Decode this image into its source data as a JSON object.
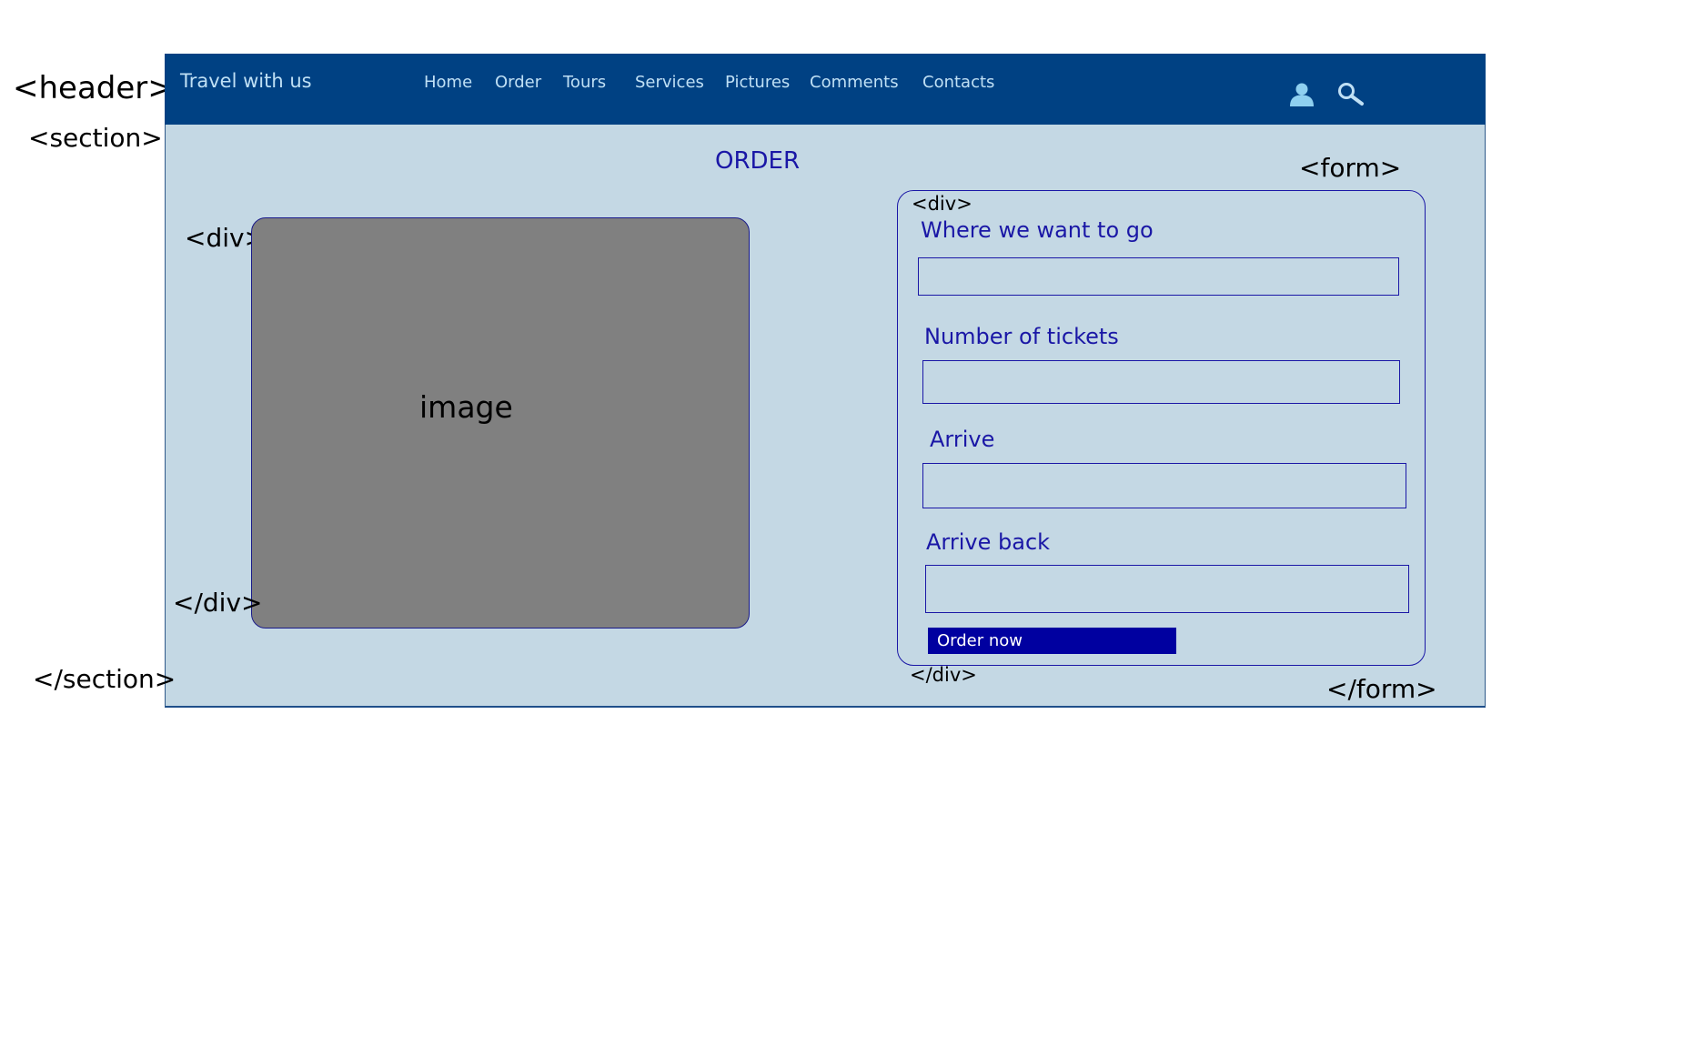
{
  "annotations": {
    "header_open": "<header>",
    "section_open": "<section>",
    "section_close": "</section>",
    "div_open": "<div>",
    "div_close": "</div>",
    "form_open": "<form>",
    "form_close": "</form>",
    "form_div_open": "<div>",
    "form_div_close": "</div>"
  },
  "header": {
    "brand": "Travel with us",
    "nav": [
      "Home",
      "Order",
      "Tours",
      "Services",
      "Pictures",
      "Comments",
      "Contacts"
    ],
    "icons": [
      "user-icon",
      "search-icon"
    ]
  },
  "section": {
    "title": "ORDER",
    "image_label": "image"
  },
  "form": {
    "fields": [
      {
        "label": "Where we want to go",
        "value": ""
      },
      {
        "label": "Number of tickets",
        "value": ""
      },
      {
        "label": "Arrive",
        "value": ""
      },
      {
        "label": "Arrive back",
        "value": ""
      }
    ],
    "submit_label": "Order now"
  },
  "colors": {
    "header_bg": "#004183",
    "section_bg": "#c4d8e4",
    "accent_text": "#1a17a6",
    "button_bg": "#0000a0",
    "image_placeholder": "#808080"
  }
}
